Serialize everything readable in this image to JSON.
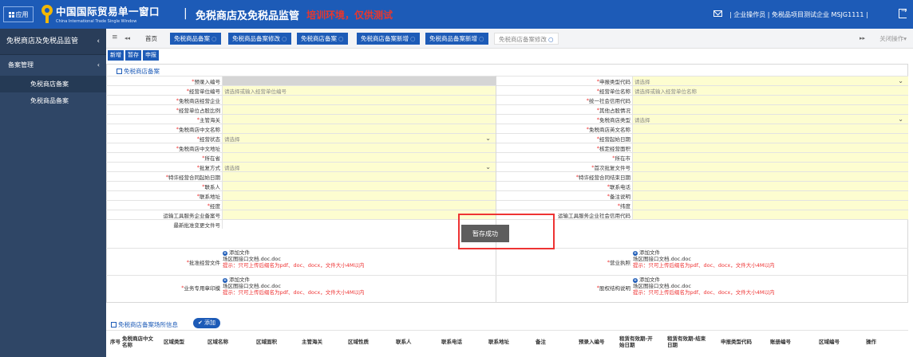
{
  "topbar": {
    "app_label": "应用",
    "brand_cn": "中国国际贸易单一窗口",
    "brand_en": "China International Trade Single Window",
    "separator": "|",
    "system_title": "免税商店及免税品监管",
    "env_note": "培训环境，仅供测试",
    "user_info": "| 企业操作员 | 免税品项目测试企业 MSJG1111 |"
  },
  "sidebar": {
    "header": "免税商店及免税品监管",
    "header_chevron": "‹",
    "group": "备案管理",
    "group_chevron": "‹",
    "items": [
      {
        "label": "免税商店备案"
      },
      {
        "label": "免税商品备案"
      }
    ]
  },
  "tabs": {
    "menu_glyph": "≡",
    "back_glyph": "◂◂",
    "home": "首页",
    "items": [
      {
        "label": "免税商品备案"
      },
      {
        "label": "免税商品备案修改"
      },
      {
        "label": "免税商店备案"
      },
      {
        "label": "免税商店备案新增"
      },
      {
        "label": "免税商品备案新增"
      },
      {
        "label": "免税商店备案修改"
      }
    ],
    "close_glyph": "○",
    "forward_glyph": "▸▸",
    "close_ops": "关闭操作▾"
  },
  "toolbar": {
    "new": "新增",
    "save": "暂存",
    "submit": "申报"
  },
  "section_shop": "免税商店备案",
  "form": {
    "left": [
      {
        "label": "预录入编号",
        "value": ""
      },
      {
        "label": "经营单位编号",
        "value": "请选择或输入经营单位编号"
      },
      {
        "label": "免税商店经营企业",
        "value": ""
      },
      {
        "label": "经营单位占股比例",
        "value": ""
      },
      {
        "label": "主管海关",
        "value": ""
      },
      {
        "label": "免税商店中文名称",
        "value": ""
      },
      {
        "label": "经营状态",
        "value": "请选择"
      },
      {
        "label": "免税商店中文地址",
        "value": ""
      },
      {
        "label": "所在省",
        "value": ""
      },
      {
        "label": "批复方式",
        "value": "请选择"
      },
      {
        "label": "特许经营合同起始日期",
        "value": ""
      },
      {
        "label": "联系人",
        "value": ""
      },
      {
        "label": "联系地址",
        "value": ""
      },
      {
        "label": "经度",
        "value": ""
      },
      {
        "label": "运输工具服务企业备案号",
        "value": ""
      },
      {
        "label": "最新批准变更文件号",
        "value": ""
      }
    ],
    "right": [
      {
        "label": "申报类型代码",
        "value": "请选择"
      },
      {
        "label": "经营单位名称",
        "value": "请选择或输入经营单位名称"
      },
      {
        "label": "统一社会信用代码",
        "value": ""
      },
      {
        "label": "其他占股情况",
        "value": ""
      },
      {
        "label": "免税商店类型",
        "value": "请选择"
      },
      {
        "label": "免税商店英文名称",
        "value": ""
      },
      {
        "label": "经营起始日期",
        "value": ""
      },
      {
        "label": "核定经营面积",
        "value": ""
      },
      {
        "label": "所在市",
        "value": ""
      },
      {
        "label": "首次批复文件号",
        "value": ""
      },
      {
        "label": "特许经营合同结束日期",
        "value": ""
      },
      {
        "label": "联系电话",
        "value": ""
      },
      {
        "label": "备注说明",
        "value": ""
      },
      {
        "label": "纬度",
        "value": ""
      },
      {
        "label": "运输工具服务企业社会信用代码",
        "value": ""
      }
    ],
    "dropdown_glyph": "⌄"
  },
  "uploads": {
    "add_text": "添加文件",
    "file_name": "场区图接口文档.doc.doc",
    "hint": "提示：只可上传后缀名为pdf、doc、docx，文件大小4M以内",
    "labels": [
      "批准经营文件",
      "业务专用章印模",
      "营业执照",
      "股权结构说明"
    ]
  },
  "toast": "暂存成功",
  "area_section": {
    "title": "免税商店备案场所信息",
    "add_button": "添加",
    "columns": [
      "序号",
      "免税商店中文名称",
      "区域类型",
      "区域名称",
      "区域面积",
      "主管海关",
      "区域性质",
      "联系人",
      "联系电话",
      "联系地址",
      "备注",
      "预录入编号",
      "租赁有效期-开始日期",
      "租赁有效期-结束日期",
      "申报类型代码",
      "账册编号",
      "区域编号",
      "操作"
    ]
  }
}
